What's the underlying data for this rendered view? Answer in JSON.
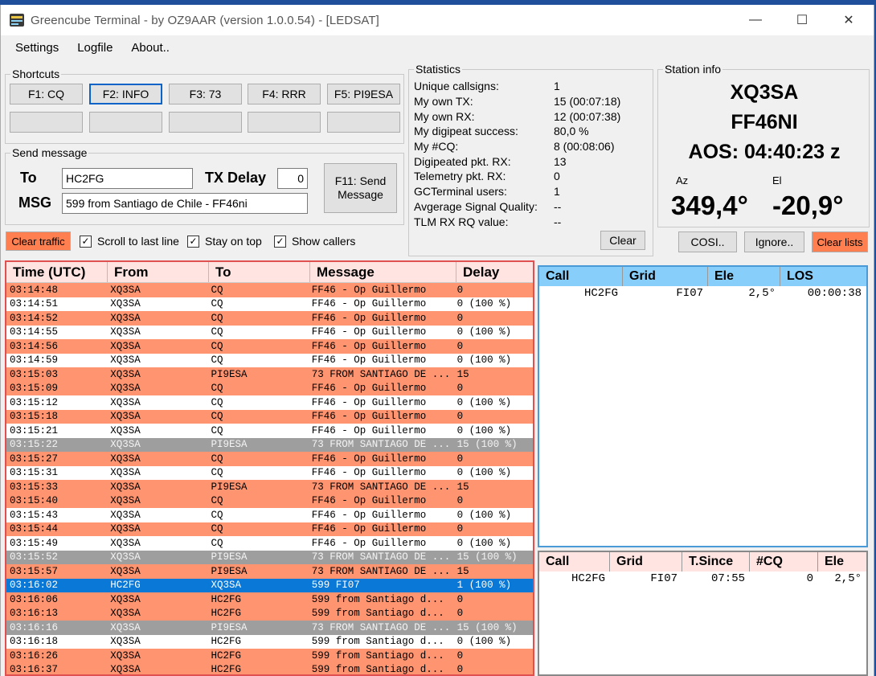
{
  "window": {
    "title": "Greencube Terminal - by OZ9AAR (version 1.0.0.54) - [LEDSAT]",
    "minimize": "—",
    "maximize": "☐",
    "close": "✕"
  },
  "menu": [
    "Settings",
    "Logfile",
    "About.."
  ],
  "shortcuts": {
    "title": "Shortcuts",
    "buttons": [
      "F1: CQ",
      "F2: INFO",
      "F3: 73",
      "F4: RRR",
      "F5: PI9ESA"
    ],
    "empty_buttons": [
      "",
      "",
      "",
      "",
      ""
    ]
  },
  "send_message": {
    "title": "Send message",
    "to_label": "To",
    "to_value": "HC2FG",
    "txdelay_label": "TX Delay",
    "txdelay_value": "0",
    "msg_label": "MSG",
    "msg_value": "599 from Santiago de Chile - FF46ni",
    "send_button": "F11: Send Message"
  },
  "controls": {
    "clear_traffic": "Clear traffic",
    "scroll_last": "Scroll to last line",
    "stay_on_top": "Stay on top",
    "show_callers": "Show callers",
    "check_mark": "✓"
  },
  "statistics": {
    "title": "Statistics",
    "rows": [
      {
        "label": "Unique callsigns:",
        "value": "1"
      },
      {
        "label": "My own TX:",
        "value": "15   (00:07:18)"
      },
      {
        "label": "My own RX:",
        "value": "12   (00:07:38)"
      },
      {
        "label": "My digipeat success:",
        "value": "80,0 %"
      },
      {
        "label": "My #CQ:",
        "value": "8   (00:08:06)"
      },
      {
        "label": "Digipeated pkt. RX:",
        "value": "13"
      },
      {
        "label": "Telemetry pkt. RX:",
        "value": "0"
      },
      {
        "label": "GCTerminal users:",
        "value": "1"
      },
      {
        "label": "Avgerage Signal Quality:",
        "value": "--"
      },
      {
        "label": "TLM RX RQ value:",
        "value": "--"
      }
    ],
    "clear_button": "Clear"
  },
  "station": {
    "title": "Station info",
    "callsign": "XQ3SA",
    "grid": "FF46NI",
    "aos": "AOS: 04:40:23 z",
    "az_label": "Az",
    "el_label": "El",
    "az_value": "349,4°",
    "el_value": "-20,9°"
  },
  "station_buttons": {
    "cosi": "COSI..",
    "ignore": "Ignore..",
    "clear_lists": "Clear lists"
  },
  "traffic": {
    "headers": [
      "Time (UTC)",
      "From",
      "To",
      "Message",
      "Delay"
    ],
    "rows": [
      {
        "style": "orange",
        "cells": [
          "03:14:48",
          "XQ3SA",
          "CQ",
          "FF46 - Op Guillermo",
          "0"
        ]
      },
      {
        "style": "white",
        "cells": [
          "03:14:51",
          "XQ3SA",
          "CQ",
          "FF46 - Op Guillermo",
          "0 (100 %)"
        ]
      },
      {
        "style": "orange",
        "cells": [
          "03:14:52",
          "XQ3SA",
          "CQ",
          "FF46 - Op Guillermo",
          "0"
        ]
      },
      {
        "style": "white",
        "cells": [
          "03:14:55",
          "XQ3SA",
          "CQ",
          "FF46 - Op Guillermo",
          "0 (100 %)"
        ]
      },
      {
        "style": "orange",
        "cells": [
          "03:14:56",
          "XQ3SA",
          "CQ",
          "FF46 - Op Guillermo",
          "0"
        ]
      },
      {
        "style": "white",
        "cells": [
          "03:14:59",
          "XQ3SA",
          "CQ",
          "FF46 - Op Guillermo",
          "0 (100 %)"
        ]
      },
      {
        "style": "orange",
        "cells": [
          "03:15:03",
          "XQ3SA",
          "PI9ESA",
          "73 FROM SANTIAGO DE ...",
          "15"
        ]
      },
      {
        "style": "orange",
        "cells": [
          "03:15:09",
          "XQ3SA",
          "CQ",
          "FF46 - Op Guillermo",
          "0"
        ]
      },
      {
        "style": "white",
        "cells": [
          "03:15:12",
          "XQ3SA",
          "CQ",
          "FF46 - Op Guillermo",
          "0 (100 %)"
        ]
      },
      {
        "style": "orange",
        "cells": [
          "03:15:18",
          "XQ3SA",
          "CQ",
          "FF46 - Op Guillermo",
          "0"
        ]
      },
      {
        "style": "white",
        "cells": [
          "03:15:21",
          "XQ3SA",
          "CQ",
          "FF46 - Op Guillermo",
          "0 (100 %)"
        ]
      },
      {
        "style": "gray",
        "cells": [
          "03:15:22",
          "XQ3SA",
          "PI9ESA",
          "73 FROM SANTIAGO DE ...",
          "15 (100 %)"
        ]
      },
      {
        "style": "orange",
        "cells": [
          "03:15:27",
          "XQ3SA",
          "CQ",
          "FF46 - Op Guillermo",
          "0"
        ]
      },
      {
        "style": "white",
        "cells": [
          "03:15:31",
          "XQ3SA",
          "CQ",
          "FF46 - Op Guillermo",
          "0 (100 %)"
        ]
      },
      {
        "style": "orange",
        "cells": [
          "03:15:33",
          "XQ3SA",
          "PI9ESA",
          "73 FROM SANTIAGO DE ...",
          "15"
        ]
      },
      {
        "style": "orange",
        "cells": [
          "03:15:40",
          "XQ3SA",
          "CQ",
          "FF46 - Op Guillermo",
          "0"
        ]
      },
      {
        "style": "white",
        "cells": [
          "03:15:43",
          "XQ3SA",
          "CQ",
          "FF46 - Op Guillermo",
          "0 (100 %)"
        ]
      },
      {
        "style": "orange",
        "cells": [
          "03:15:44",
          "XQ3SA",
          "CQ",
          "FF46 - Op Guillermo",
          "0"
        ]
      },
      {
        "style": "white",
        "cells": [
          "03:15:49",
          "XQ3SA",
          "CQ",
          "FF46 - Op Guillermo",
          "0 (100 %)"
        ]
      },
      {
        "style": "gray",
        "cells": [
          "03:15:52",
          "XQ3SA",
          "PI9ESA",
          "73 FROM SANTIAGO DE ...",
          "15 (100 %)"
        ]
      },
      {
        "style": "orange",
        "cells": [
          "03:15:57",
          "XQ3SA",
          "PI9ESA",
          "73 FROM SANTIAGO DE ...",
          "15"
        ]
      },
      {
        "style": "blue",
        "cells": [
          "03:16:02",
          "HC2FG",
          "XQ3SA",
          "599 FI07",
          "1 (100 %)"
        ]
      },
      {
        "style": "orange",
        "cells": [
          "03:16:06",
          "XQ3SA",
          "HC2FG",
          "599  from Santiago d...",
          "0"
        ]
      },
      {
        "style": "orange",
        "cells": [
          "03:16:13",
          "XQ3SA",
          "HC2FG",
          "599  from Santiago d...",
          "0"
        ]
      },
      {
        "style": "gray",
        "cells": [
          "03:16:16",
          "XQ3SA",
          "PI9ESA",
          "73 FROM SANTIAGO DE ...",
          "15 (100 %)"
        ]
      },
      {
        "style": "white",
        "cells": [
          "03:16:18",
          "XQ3SA",
          "HC2FG",
          "599  from Santiago d...",
          "0 (100 %)"
        ]
      },
      {
        "style": "orange",
        "cells": [
          "03:16:26",
          "XQ3SA",
          "HC2FG",
          "599  from Santiago d...",
          "0"
        ]
      },
      {
        "style": "orange",
        "cells": [
          "03:16:37",
          "XQ3SA",
          "HC2FG",
          "599  from Santiago d...",
          "0"
        ]
      }
    ]
  },
  "calls_table": {
    "headers": [
      "Call",
      "Grid",
      "Ele",
      "LOS"
    ],
    "rows": [
      [
        "HC2FG",
        "FI07",
        "2,5°",
        "00:00:38"
      ]
    ]
  },
  "callers_table": {
    "headers": [
      "Call",
      "Grid",
      "T.Since",
      "#CQ",
      "Ele"
    ],
    "rows": [
      [
        "HC2FG",
        "FI07",
        "07:55",
        "0",
        "2,5°"
      ]
    ]
  },
  "colors": {
    "orange_row": "#ff9470",
    "gray_row": "#9e9e9e",
    "selected_row": "#0a78d7",
    "calls_header": "#87cefa",
    "callers_header": "#ffe4e1"
  }
}
